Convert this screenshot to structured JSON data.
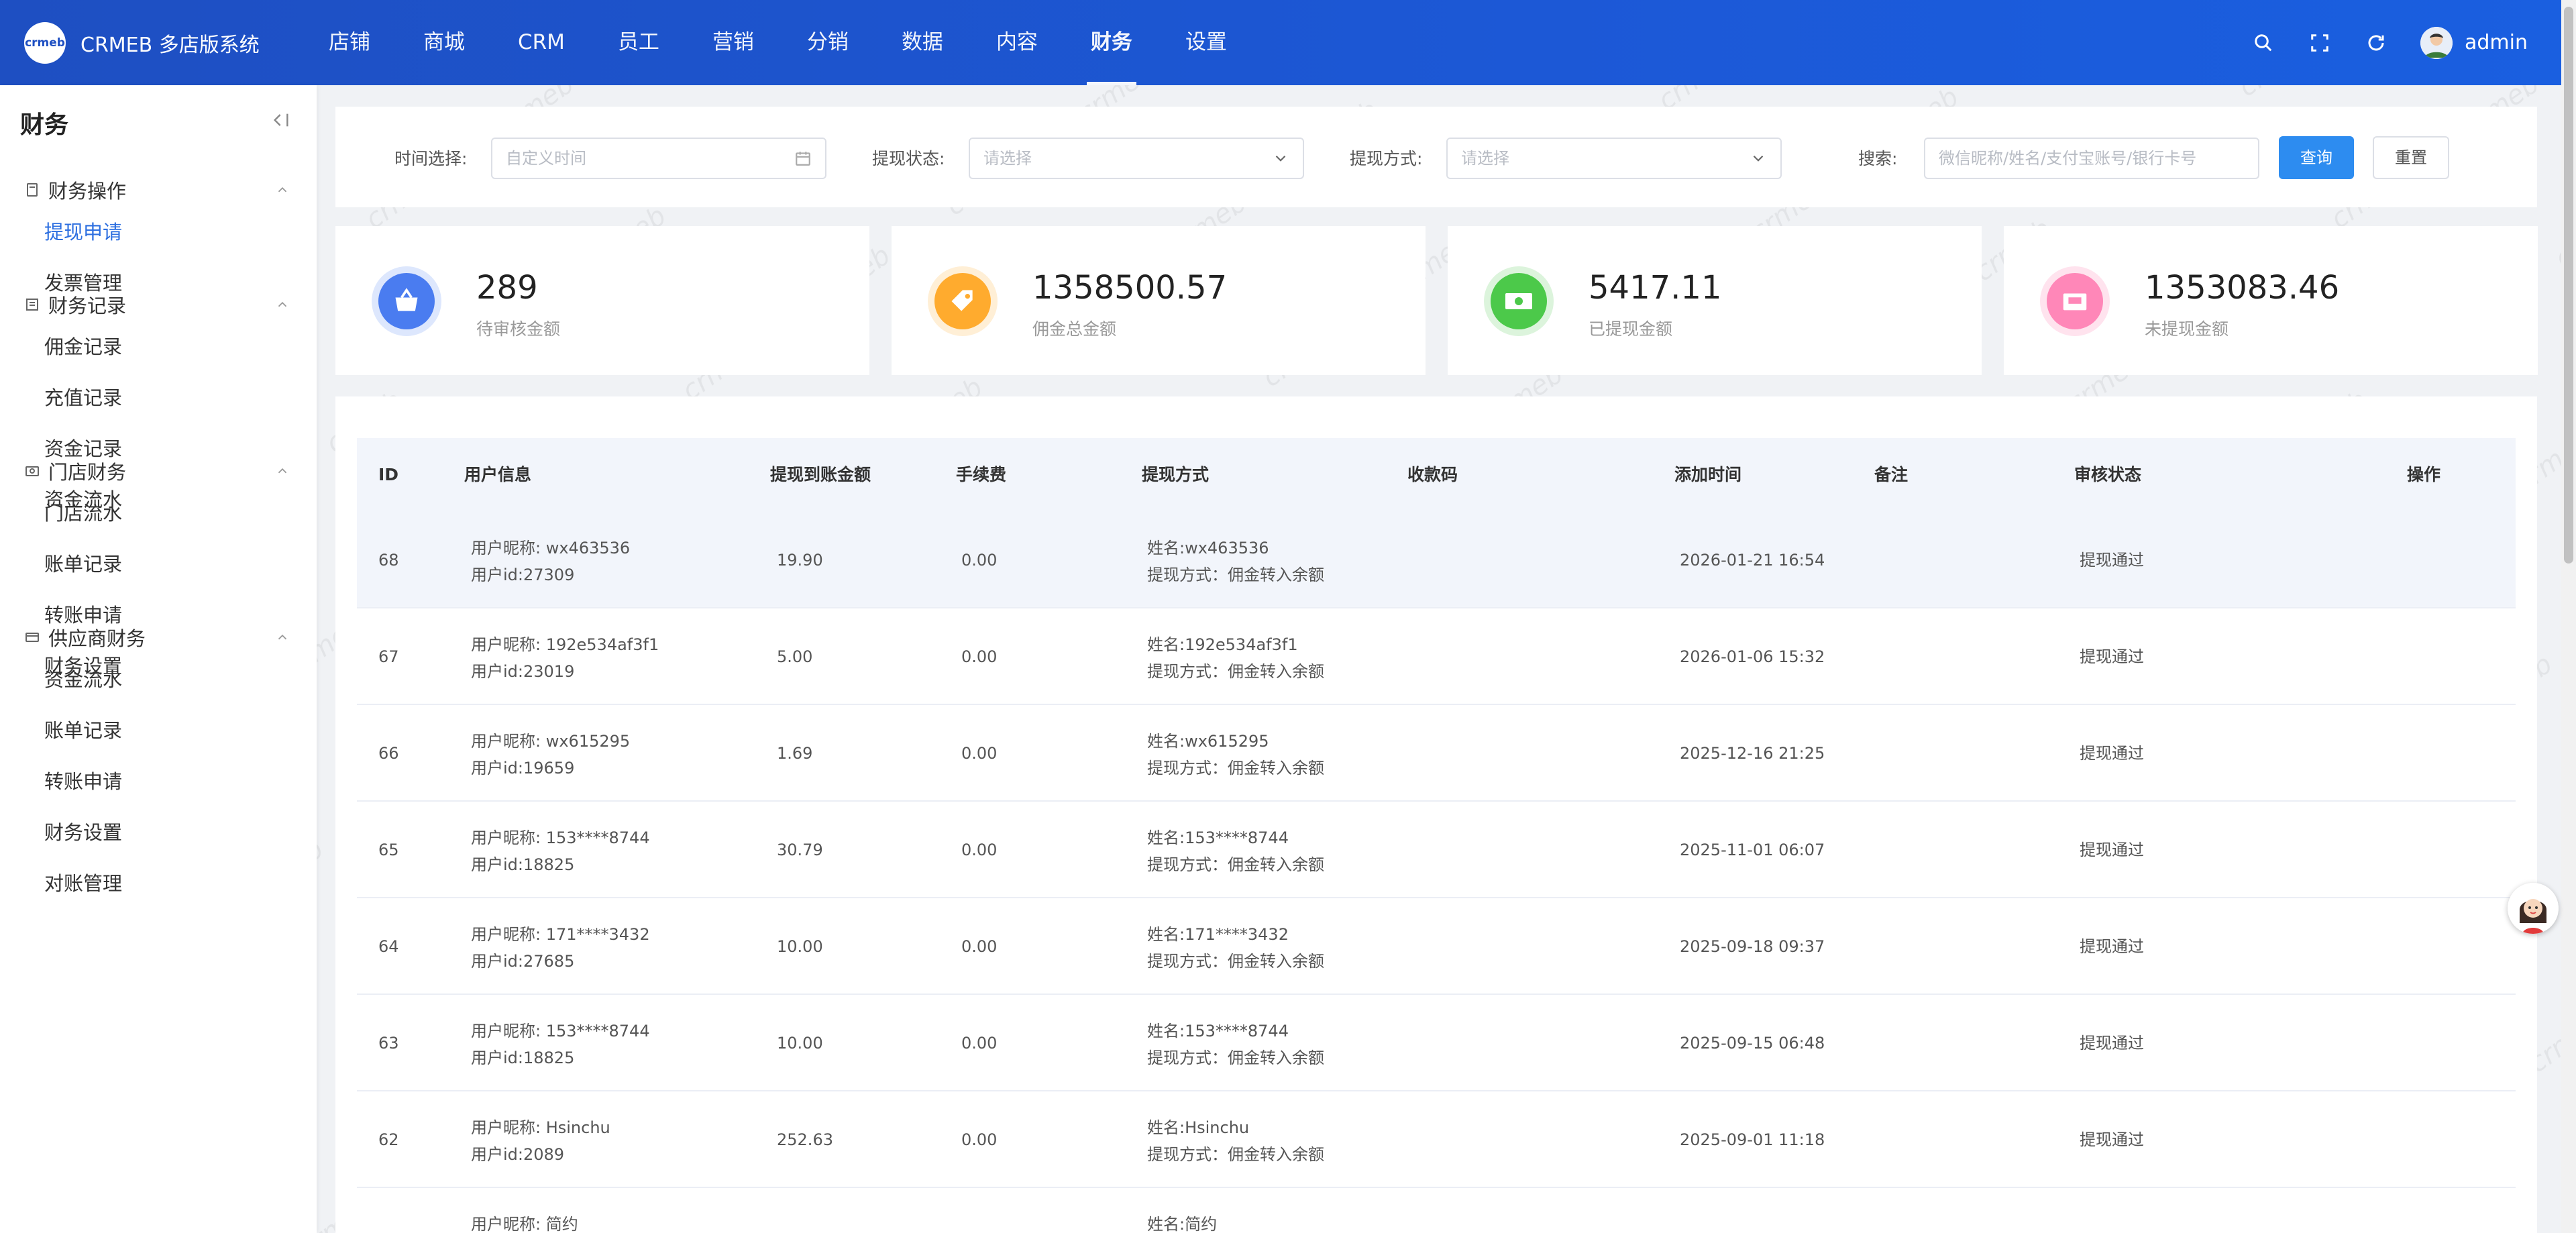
{
  "header": {
    "logo_mark": "crmeb",
    "brand": "CRMEB 多店版系统",
    "nav": [
      {
        "label": "店铺"
      },
      {
        "label": "商城"
      },
      {
        "label": "CRM"
      },
      {
        "label": "员工"
      },
      {
        "label": "营销"
      },
      {
        "label": "分销"
      },
      {
        "label": "数据"
      },
      {
        "label": "内容"
      },
      {
        "label": "财务",
        "active": true
      },
      {
        "label": "设置"
      }
    ],
    "user": "admin",
    "colors": {
      "bar_start": "#1e4fc2",
      "bar_end": "#1a5fe0"
    }
  },
  "sidebar": {
    "title": "财务",
    "groups": [
      {
        "label": "财务操作",
        "icon": "document-icon",
        "items": [
          "提现申请",
          "发票管理"
        ],
        "active_item": 0
      },
      {
        "label": "财务记录",
        "icon": "list-icon",
        "items": [
          "佣金记录",
          "充值记录",
          "资金记录",
          "资金流水"
        ]
      },
      {
        "label": "门店财务",
        "icon": "store-icon",
        "items": [
          "门店流水",
          "账单记录",
          "转账申请",
          "财务设置"
        ]
      },
      {
        "label": "供应商财务",
        "icon": "card-icon",
        "items": [
          "资金流水",
          "账单记录",
          "转账申请",
          "财务设置",
          "对账管理"
        ]
      }
    ]
  },
  "filters": {
    "time_label": "时间选择:",
    "time_placeholder": "自定义时间",
    "status_label": "提现状态:",
    "status_placeholder": "请选择",
    "method_label": "提现方式:",
    "method_placeholder": "请选择",
    "search_label": "搜索:",
    "search_placeholder": "微信昵称/姓名/支付宝账号/银行卡号",
    "query_button": "查询",
    "reset_button": "重置"
  },
  "stats": [
    {
      "value": "289",
      "label": "待审核金额",
      "icon": "basket-icon",
      "color": "#4a7cf0",
      "ring": "#dde7fd"
    },
    {
      "value": "1358500.57",
      "label": "佣金总金额",
      "icon": "tag-icon",
      "color": "#ffab2e",
      "ring": "#ffefd6"
    },
    {
      "value": "5417.11",
      "label": "已提现金额",
      "icon": "cash-icon",
      "color": "#4cc94a",
      "ring": "#dcf4dc"
    },
    {
      "value": "1353083.46",
      "label": "未提现金额",
      "icon": "cash-register-icon",
      "color": "#ff87b8",
      "ring": "#ffe3ee"
    }
  ],
  "table": {
    "columns": [
      "ID",
      "用户信息",
      "提现到账金额",
      "手续费",
      "提现方式",
      "收款码",
      "添加时间",
      "备注",
      "审核状态",
      "操作"
    ],
    "rows": [
      {
        "id": "68",
        "nick": "用户昵称: wx463536",
        "uid": "用户id:27309",
        "amount": "19.90",
        "fee": "0.00",
        "name": "姓名:wx463536",
        "method": "提现方式：佣金转入余额",
        "time": "2026-01-21 16:54",
        "status": "提现通过"
      },
      {
        "id": "67",
        "nick": "用户昵称: 192e534af3f1",
        "uid": "用户id:23019",
        "amount": "5.00",
        "fee": "0.00",
        "name": "姓名:192e534af3f1",
        "method": "提现方式：佣金转入余额",
        "time": "2026-01-06 15:32",
        "status": "提现通过"
      },
      {
        "id": "66",
        "nick": "用户昵称: wx615295",
        "uid": "用户id:19659",
        "amount": "1.69",
        "fee": "0.00",
        "name": "姓名:wx615295",
        "method": "提现方式：佣金转入余额",
        "time": "2025-12-16 21:25",
        "status": "提现通过"
      },
      {
        "id": "65",
        "nick": "用户昵称: 153****8744",
        "uid": "用户id:18825",
        "amount": "30.79",
        "fee": "0.00",
        "name": "姓名:153****8744",
        "method": "提现方式：佣金转入余额",
        "time": "2025-11-01 06:07",
        "status": "提现通过"
      },
      {
        "id": "64",
        "nick": "用户昵称: 171****3432",
        "uid": "用户id:27685",
        "amount": "10.00",
        "fee": "0.00",
        "name": "姓名:171****3432",
        "method": "提现方式：佣金转入余额",
        "time": "2025-09-18 09:37",
        "status": "提现通过"
      },
      {
        "id": "63",
        "nick": "用户昵称: 153****8744",
        "uid": "用户id:18825",
        "amount": "10.00",
        "fee": "0.00",
        "name": "姓名:153****8744",
        "method": "提现方式：佣金转入余额",
        "time": "2025-09-15 06:48",
        "status": "提现通过"
      },
      {
        "id": "62",
        "nick": "用户昵称: Hsinchu",
        "uid": "用户id:2089",
        "amount": "252.63",
        "fee": "0.00",
        "name": "姓名:Hsinchu",
        "method": "提现方式：佣金转入余额",
        "time": "2025-09-01 11:18",
        "status": "提现通过"
      },
      {
        "id": "",
        "nick": "用户昵称: 简约",
        "uid": "",
        "amount": "",
        "fee": "",
        "name": "姓名:简约",
        "method": "",
        "time": "",
        "status": ""
      }
    ]
  },
  "accent": "#2d8cf0"
}
